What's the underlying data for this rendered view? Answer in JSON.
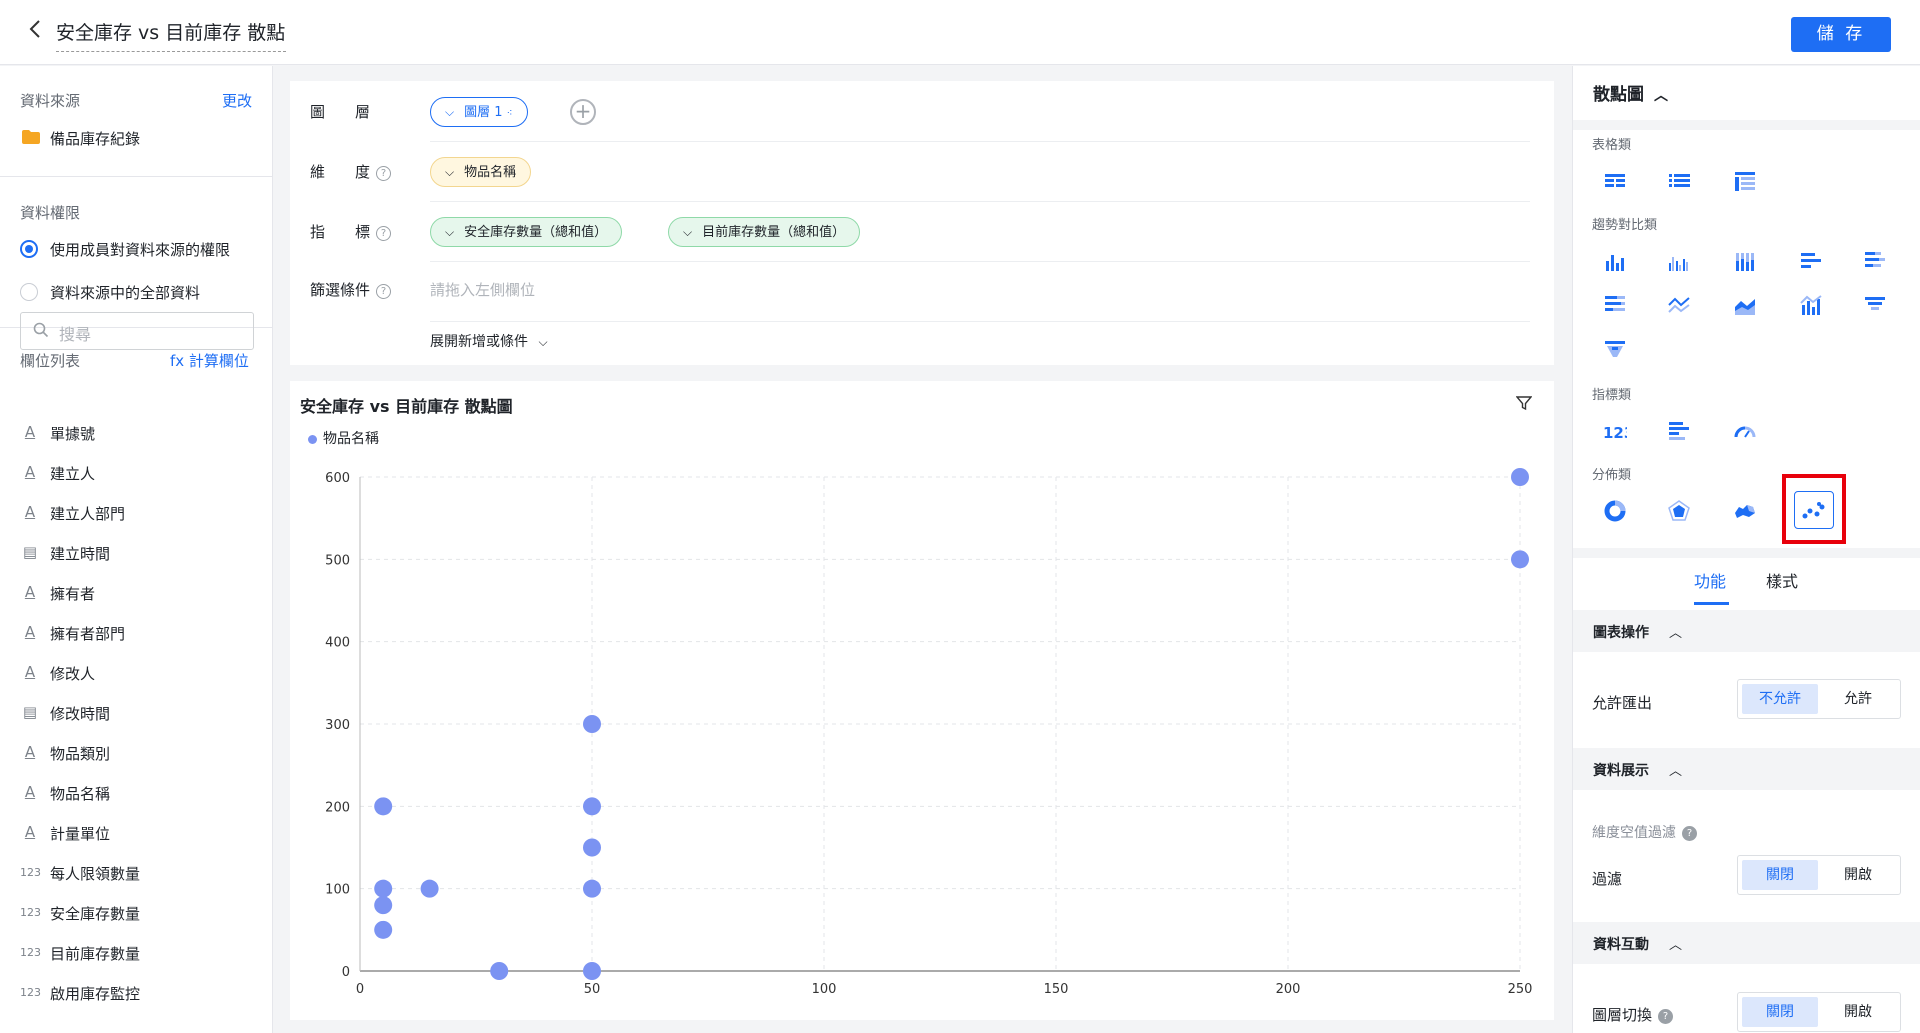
{
  "header": {
    "back_icon": "chevron-left-icon",
    "title": "安全庫存 vs 目前庫存 散點",
    "save_label": "儲 存"
  },
  "sidebar": {
    "data_source_label": "資料來源",
    "change_link": "更改",
    "source_name": "備品庫存紀錄",
    "permission_label": "資料權限",
    "permission_options": [
      {
        "label": "使用成員對資料來源的權限",
        "selected": true
      },
      {
        "label": "資料來源中的全部資料",
        "selected": false
      }
    ],
    "field_list_label": "欄位列表",
    "calc_field_link": "fx 計算欄位",
    "search_placeholder": "搜尋",
    "fields": [
      {
        "icon": "text-icon",
        "glyph": "A",
        "label": "單據號"
      },
      {
        "icon": "text-icon",
        "glyph": "A",
        "label": "建立人"
      },
      {
        "icon": "text-icon",
        "glyph": "A",
        "label": "建立人部門"
      },
      {
        "icon": "calendar-icon",
        "glyph": "▤",
        "label": "建立時間"
      },
      {
        "icon": "text-icon",
        "glyph": "A",
        "label": "擁有者"
      },
      {
        "icon": "text-icon",
        "glyph": "A",
        "label": "擁有者部門"
      },
      {
        "icon": "text-icon",
        "glyph": "A",
        "label": "修改人"
      },
      {
        "icon": "calendar-icon",
        "glyph": "▤",
        "label": "修改時間"
      },
      {
        "icon": "text-icon",
        "glyph": "A",
        "label": "物品類別"
      },
      {
        "icon": "text-icon",
        "glyph": "A",
        "label": "物品名稱"
      },
      {
        "icon": "text-icon",
        "glyph": "A",
        "label": "計量單位"
      },
      {
        "icon": "number-icon",
        "glyph": "123",
        "label": "每人限領數量"
      },
      {
        "icon": "number-icon",
        "glyph": "123",
        "label": "安全庫存數量"
      },
      {
        "icon": "number-icon",
        "glyph": "123",
        "label": "目前庫存數量"
      },
      {
        "icon": "number-icon",
        "glyph": "123",
        "label": "啟用庫存監控"
      }
    ]
  },
  "config": {
    "layer_label": "圖　　層",
    "layer_pill": "圖層 1",
    "dimension_label": "維　　度",
    "dimension_pill": "物品名稱",
    "metric_label": "指　　標",
    "metric_pills": [
      "安全庫存數量（總和值）",
      "目前庫存數量（總和值）"
    ],
    "filter_label": "篩選條件",
    "filter_placeholder": "請拖入左側欄位",
    "expand_label": "展開新增或條件"
  },
  "chart": {
    "title": "安全庫存 vs 目前庫存 散點圖",
    "legend": "物品名稱",
    "dot_color": "#7b93f2"
  },
  "chart_data": {
    "type": "scatter",
    "title": "安全庫存 vs 目前庫存 散點圖",
    "xlabel": "",
    "ylabel": "",
    "xlim": [
      0,
      250
    ],
    "ylim": [
      0,
      600
    ],
    "xticks": [
      0,
      50,
      100,
      150,
      200,
      250
    ],
    "yticks": [
      0,
      100,
      200,
      300,
      400,
      500,
      600
    ],
    "grid": true,
    "legend_position": "top-left",
    "series": [
      {
        "name": "物品名稱",
        "points": [
          [
            5,
            200
          ],
          [
            5,
            100
          ],
          [
            5,
            80
          ],
          [
            5,
            50
          ],
          [
            15,
            100
          ],
          [
            30,
            0
          ],
          [
            50,
            300
          ],
          [
            50,
            200
          ],
          [
            50,
            150
          ],
          [
            50,
            100
          ],
          [
            50,
            0
          ],
          [
            250,
            600
          ],
          [
            250,
            500
          ]
        ]
      }
    ]
  },
  "right_panel": {
    "title": "散點圖",
    "categories": [
      "表格類",
      "趨勢對比類",
      "指標類",
      "分佈類"
    ],
    "tabs": [
      "功能",
      "樣式"
    ],
    "sections": {
      "chart_ops": "圖表操作",
      "allow_export_label": "允許匯出",
      "allow_export_options": [
        "不允許",
        "允許"
      ],
      "data_display": "資料展示",
      "null_filter_label": "維度空值過濾",
      "filter_label": "過濾",
      "filter_options": [
        "關閉",
        "開啟"
      ],
      "data_interaction": "資料互動",
      "layer_switch_label": "圖層切換",
      "layer_switch_options": [
        "關閉",
        "開啟"
      ]
    },
    "accent": "#1e6ef4",
    "highlight_color": "#e8000b"
  }
}
